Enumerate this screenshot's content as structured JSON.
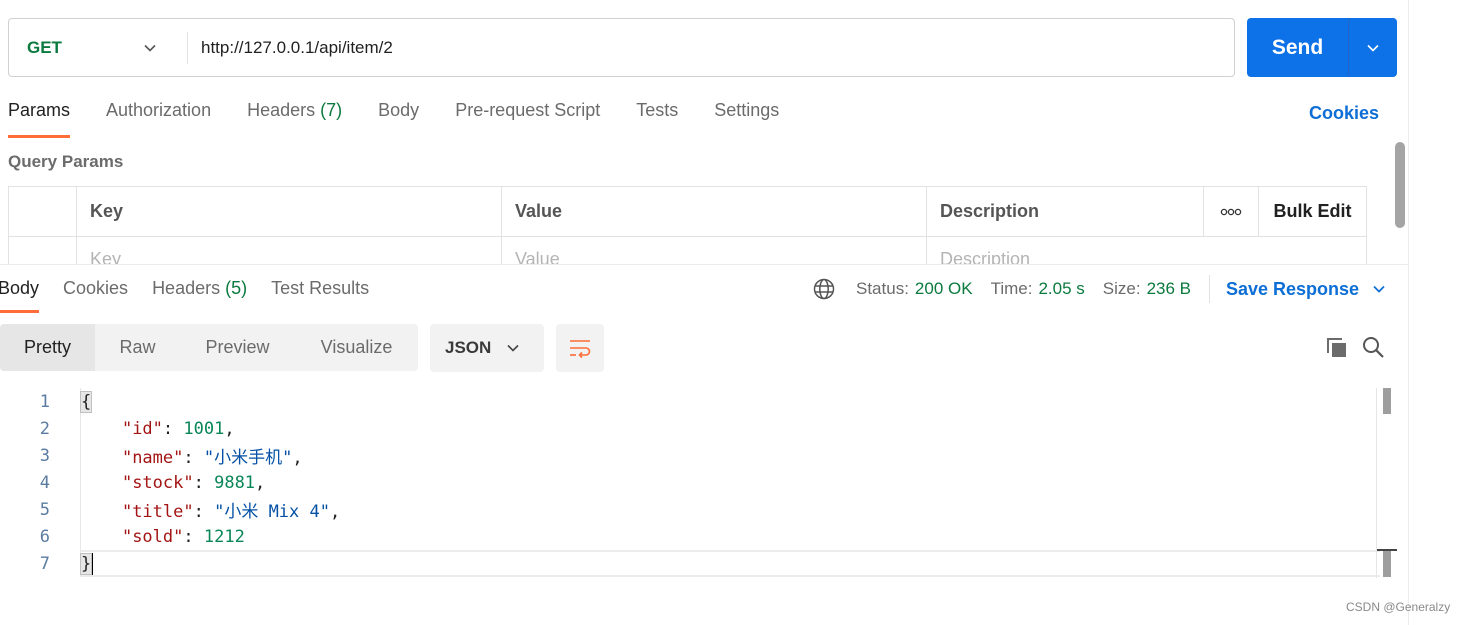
{
  "request": {
    "method": "GET",
    "url": "http://127.0.0.1/api/item/2",
    "send_label": "Send",
    "tabs": [
      {
        "label": "Params"
      },
      {
        "label": "Authorization"
      },
      {
        "label": "Headers",
        "count": "(7)"
      },
      {
        "label": "Body"
      },
      {
        "label": "Pre-request Script"
      },
      {
        "label": "Tests"
      },
      {
        "label": "Settings"
      }
    ],
    "cookies_label": "Cookies",
    "query_params_title": "Query Params",
    "table": {
      "headers": [
        "Key",
        "Value",
        "Description",
        "Bulk Edit"
      ],
      "placeholders": [
        "Key",
        "Value",
        "Description"
      ]
    }
  },
  "response": {
    "tabs": [
      {
        "label": "Body"
      },
      {
        "label": "Cookies"
      },
      {
        "label": "Headers",
        "count": "(5)"
      },
      {
        "label": "Test Results"
      }
    ],
    "status_label": "Status:",
    "status_value": "200 OK",
    "time_label": "Time:",
    "time_value": "2.05 s",
    "size_label": "Size:",
    "size_value": "236 B",
    "save_label": "Save Response",
    "views": [
      "Pretty",
      "Raw",
      "Preview",
      "Visualize"
    ],
    "format": "JSON",
    "code": {
      "line_numbers": [
        "1",
        "2",
        "3",
        "4",
        "5",
        "6",
        "7"
      ],
      "open_brace": "{",
      "close_brace": "}",
      "fields": [
        {
          "key": "\"id\"",
          "value": "1001",
          "type": "num",
          "comma": ","
        },
        {
          "key": "\"name\"",
          "value": "\"小米手机\"",
          "type": "str",
          "comma": ","
        },
        {
          "key": "\"stock\"",
          "value": "9881",
          "type": "num",
          "comma": ","
        },
        {
          "key": "\"title\"",
          "value": "\"小米 Mix 4\"",
          "type": "str",
          "comma": ","
        },
        {
          "key": "\"sold\"",
          "value": "1212",
          "type": "num",
          "comma": ""
        }
      ]
    }
  },
  "colors": {
    "accent_orange": "#ff6c37",
    "send_blue": "#0d72e8",
    "link_blue": "#0d6ed5",
    "green": "#0b7a3e"
  },
  "icons": [
    "chevron-down-icon",
    "globe-icon",
    "wrap-lines-icon",
    "copy-icon",
    "search-icon"
  ],
  "watermark": "CSDN @Generalzy"
}
